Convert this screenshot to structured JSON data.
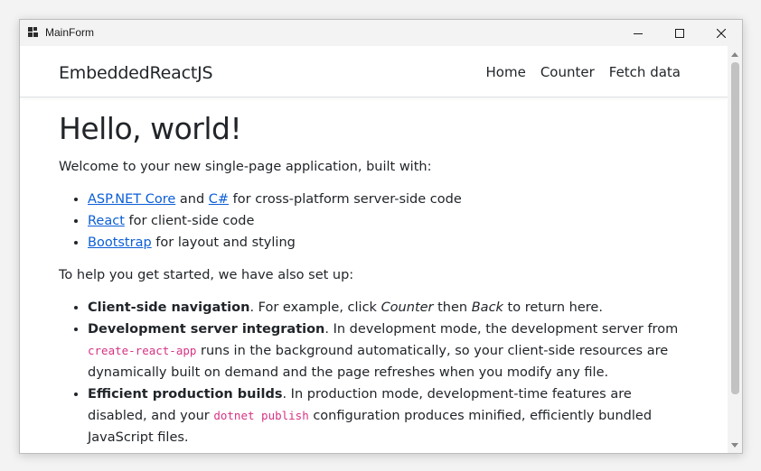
{
  "window": {
    "title": "MainForm",
    "icon": "app-window-icon",
    "controls": [
      "minimize-icon",
      "maximize-icon",
      "close-icon"
    ]
  },
  "navbar": {
    "brand": "EmbeddedReactJS",
    "links": [
      "Home",
      "Counter",
      "Fetch data"
    ]
  },
  "main": {
    "heading": "Hello, world!",
    "intro": "Welcome to your new single-page application, built with:",
    "built_with": [
      {
        "link1": "ASP.NET Core",
        "and": " and ",
        "link2": "C#",
        "rest": " for cross-platform server-side code"
      },
      {
        "link": "React",
        "rest": " for client-side code"
      },
      {
        "link": "Bootstrap",
        "rest": " for layout and styling"
      }
    ],
    "setup_intro": "To help you get started, we have also set up:",
    "features": [
      {
        "title": "Client-side navigation",
        "t1": ". For example, click ",
        "em1": "Counter",
        "t2": " then ",
        "em2": "Back",
        "t3": " to return here."
      },
      {
        "title": "Development server integration",
        "t1": ". In development mode, the development server from ",
        "code": "create-react-app",
        "t2": " runs in the background automatically, so your client-side resources are dynamically built on demand and the page refreshes when you modify any file."
      },
      {
        "title": "Efficient production builds",
        "t1": ". In production mode, development-time features are disabled, and your ",
        "code": "dotnet publish",
        "t2": " configuration produces minified, efficiently bundled JavaScript files."
      }
    ]
  },
  "colors": {
    "link": "#0b5ed7",
    "code": "#d63384",
    "text": "#212529",
    "titlebar": "#f3f3f3"
  }
}
